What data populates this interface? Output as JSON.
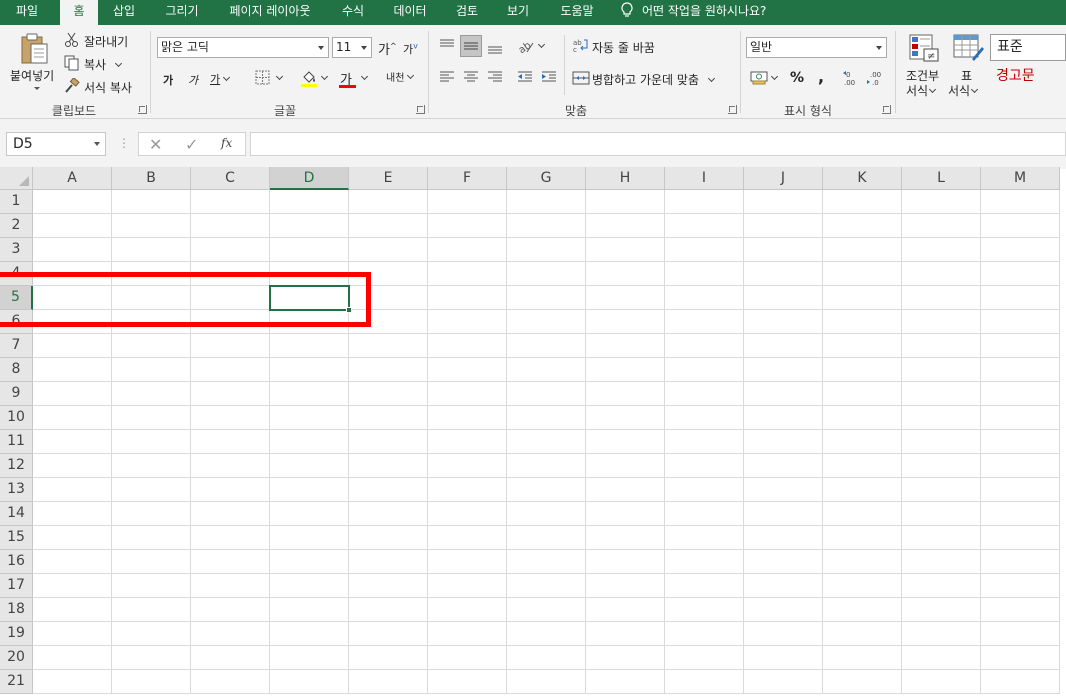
{
  "tabs": [
    "파일",
    "홈",
    "삽입",
    "그리기",
    "페이지 레이아웃",
    "수식",
    "데이터",
    "검토",
    "보기",
    "도움말"
  ],
  "active_tab": "홈",
  "tell_me": "어떤 작업을 원하시나요?",
  "clipboard": {
    "paste": "붙여넣기",
    "cut": "잘라내기",
    "copy": "복사",
    "format_painter": "서식 복사",
    "group_label": "클립보드"
  },
  "font": {
    "name": "맑은 고딕",
    "size": "11",
    "grow": "가",
    "shrink": "가",
    "bold": "가",
    "italic": "가",
    "underline": "가",
    "font_color_glyph": "가",
    "phonetic": "내천",
    "group_label": "글꼴"
  },
  "alignment": {
    "wrap_text": "자동 줄 바꿈",
    "merge_center": "병합하고 가운데 맞춤",
    "group_label": "맞춤"
  },
  "number": {
    "format": "일반",
    "percent": "%",
    "comma": ",",
    "group_label": "표시 형식"
  },
  "styles": {
    "conditional_line1": "조건부",
    "conditional_line2": "서식",
    "table_line1": "표",
    "table_line2": "서식",
    "normal": "표준",
    "bad": "경고문"
  },
  "formula_bar": {
    "name_box": "D5",
    "fx": "fx",
    "value": ""
  },
  "sheet": {
    "columns": [
      "A",
      "B",
      "C",
      "D",
      "E",
      "F",
      "G",
      "H",
      "I",
      "J",
      "K",
      "L",
      "M"
    ],
    "rows": [
      "1",
      "2",
      "3",
      "4",
      "5",
      "6",
      "7",
      "8",
      "9",
      "10",
      "11",
      "12",
      "13",
      "14",
      "15",
      "16",
      "17",
      "18",
      "19",
      "20",
      "21"
    ],
    "selected_column": "D",
    "selected_row": "5"
  },
  "colors": {
    "excel_green": "#217346",
    "highlight_red": "#ff0000",
    "bad_text": "#c00000"
  }
}
